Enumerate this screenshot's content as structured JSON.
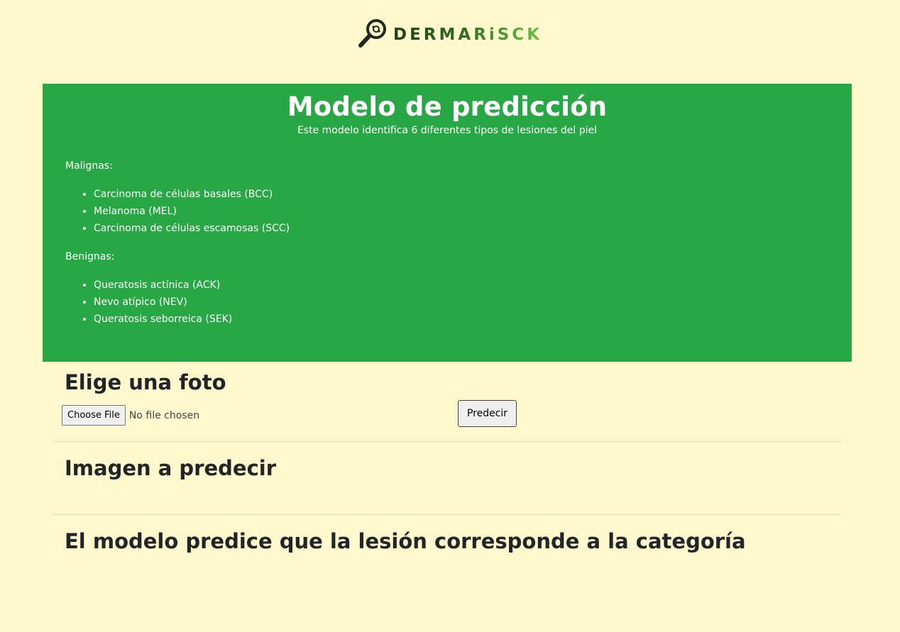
{
  "brand": {
    "logo_text": "DERMARiSCK",
    "colors": {
      "dark": "#1f3d1a",
      "light": "#6cc24a"
    },
    "icon": "magnifier-icon"
  },
  "hero": {
    "title": "Modelo de predicción",
    "subtitle": "Este modelo identifica 6 diferentes tipos de lesiones del piel",
    "malignant_label": "Malignas:",
    "malignant_items": [
      "Carcinoma de células basales (BCC)",
      "Melanoma (MEL)",
      "Carcinoma de células escamosas (SCC)"
    ],
    "benign_label": "Benignas:",
    "benign_items": [
      "Queratosis actínica (ACK)",
      "Nevo atípico (NEV)",
      "Queratosis seborreica (SEK)"
    ],
    "background_color": "#28a745"
  },
  "upload": {
    "heading": "Elige una foto",
    "choose_file_label": "Choose File",
    "file_status": "No file chosen",
    "predict_label": "Predecir"
  },
  "image_section": {
    "heading": "Imagen a predecir"
  },
  "result_section": {
    "heading": "El modelo predice que la lesión corresponde a la categoría"
  },
  "page_background": "#fff8cc"
}
